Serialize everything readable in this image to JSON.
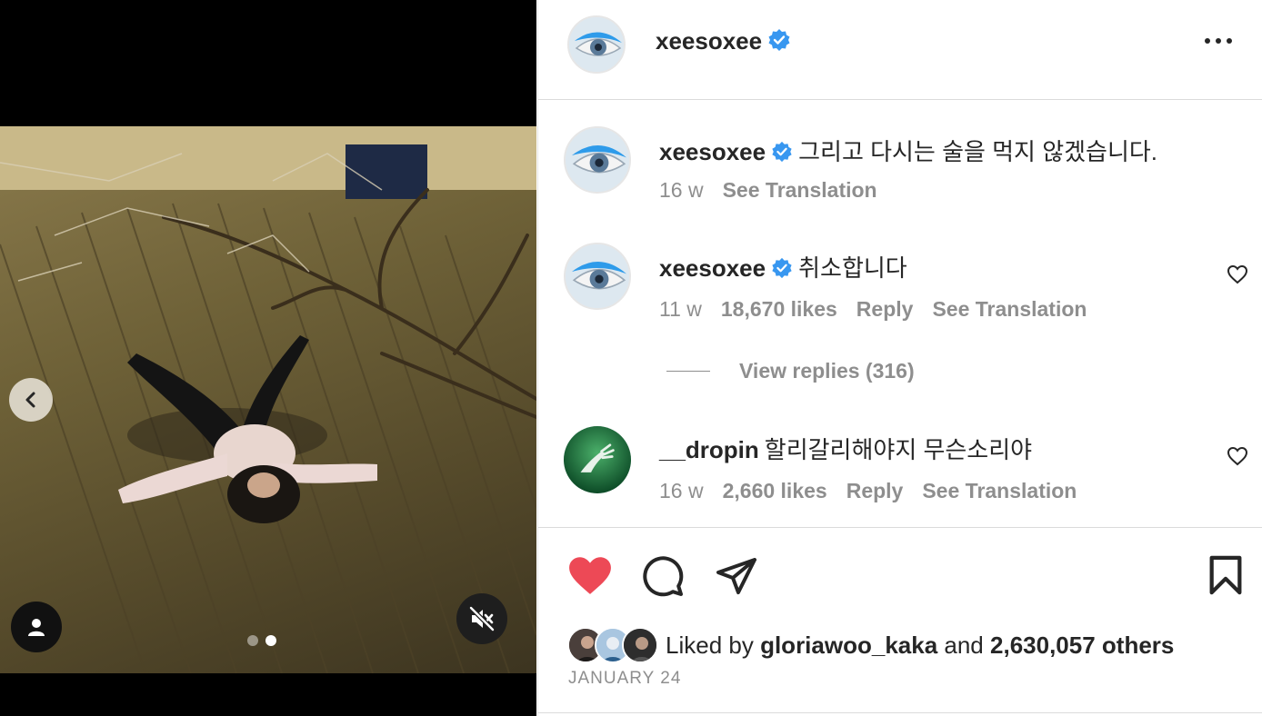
{
  "post": {
    "author": "xeesoxee",
    "verified": true,
    "date": "JANUARY 24",
    "carousel": {
      "total": 2,
      "active": 2
    }
  },
  "comments": [
    {
      "username": "xeesoxee",
      "verified": true,
      "text": "그리고 다시는 술을 먹지 않겠습니다.",
      "time": "16 w",
      "likes": "",
      "reply": "",
      "translate": "See Translation"
    },
    {
      "username": "xeesoxee",
      "verified": true,
      "text": "취소합니다",
      "time": "11 w",
      "likes": "18,670 likes",
      "reply": "Reply",
      "translate": "See Translation",
      "view_replies": "View replies (316)"
    },
    {
      "username": "__dropin",
      "verified": false,
      "text": "할리갈리해야지 무슨소리야",
      "time": "16 w",
      "likes": "2,660 likes",
      "reply": "Reply",
      "translate": "See Translation"
    }
  ],
  "likes_line": {
    "prefix": "Liked by",
    "user": "gloriawoo_kaka",
    "and": "and",
    "others": "2,630,057 others"
  },
  "icons": {
    "like": "heart-filled-icon",
    "comment": "comment-bubble-icon",
    "share": "paper-plane-icon",
    "save": "bookmark-icon",
    "more": "more-horizontal-icon",
    "mute": "speaker-muted-icon",
    "prev": "chevron-left-icon",
    "tag": "user-tag-icon"
  },
  "colors": {
    "like": "#ed4956",
    "verified": "#3897f0",
    "muted_text": "#8e8e8e"
  }
}
